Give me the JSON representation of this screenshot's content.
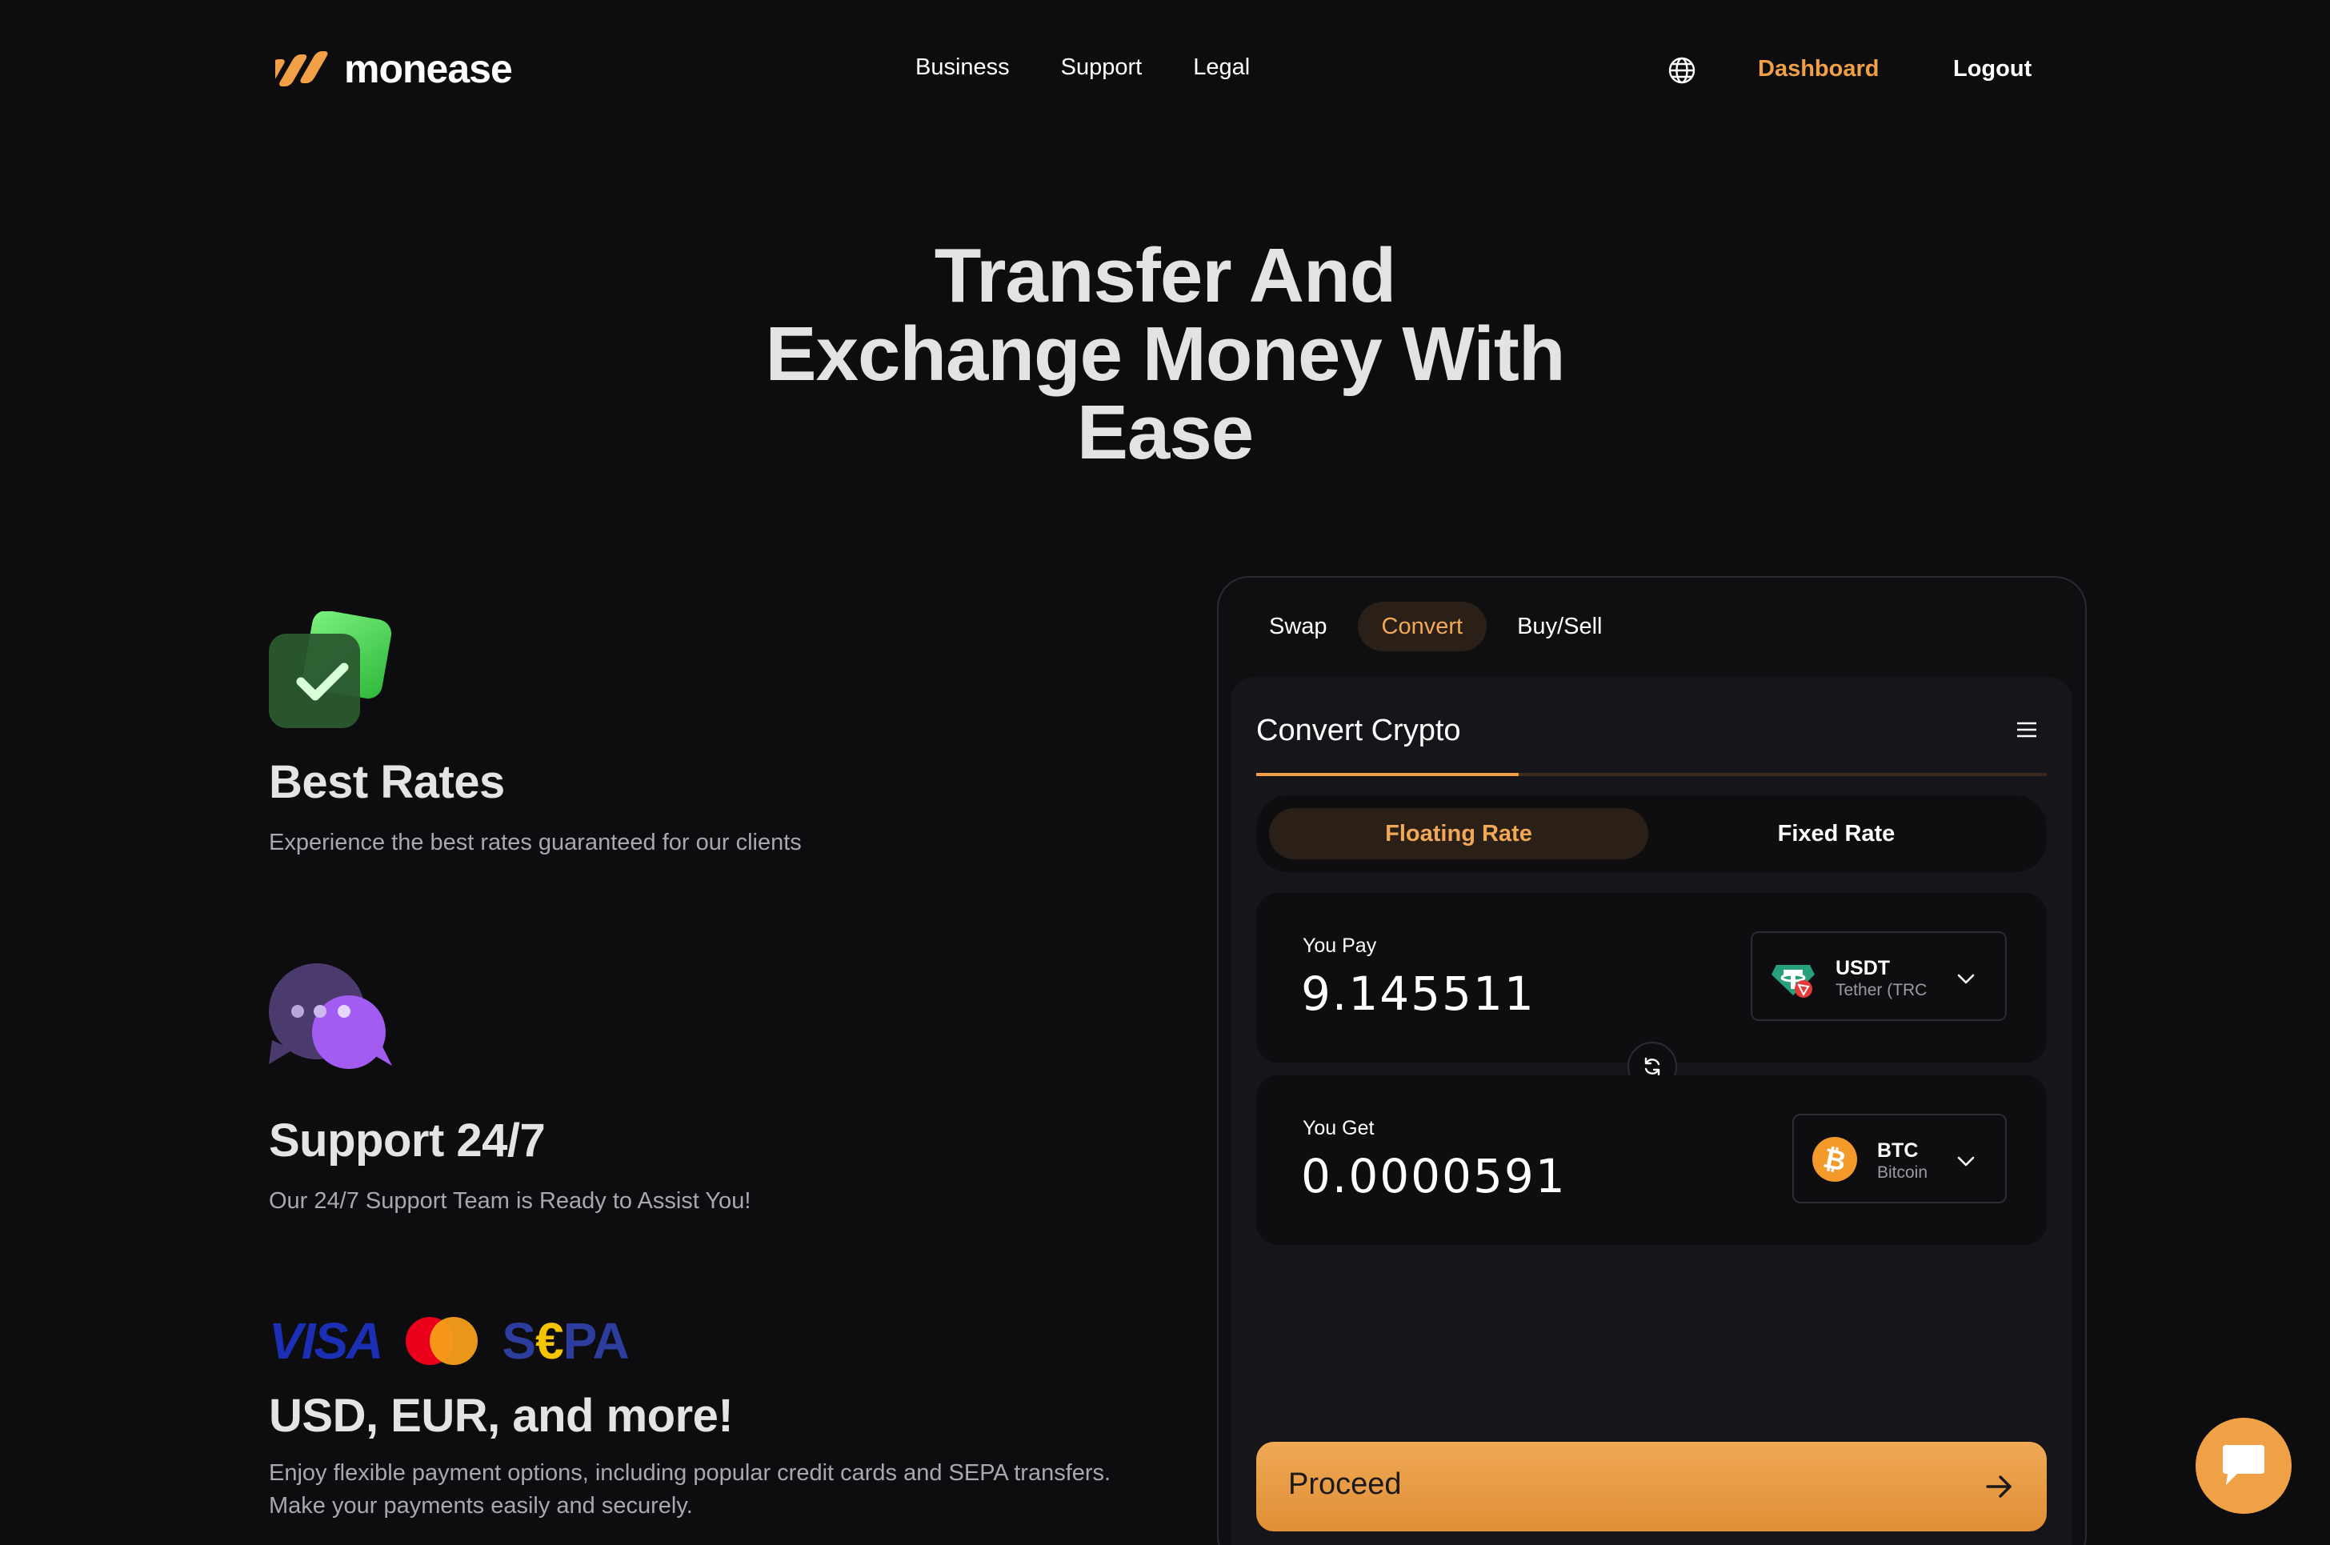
{
  "header": {
    "logo_text": "monease",
    "nav": [
      "Business",
      "Support",
      "Legal"
    ],
    "dashboard_label": "Dashboard",
    "logout_label": "Logout",
    "accent_color": "#f2a046"
  },
  "hero": {
    "line1": "Transfer And",
    "line2": "Exchange Money With",
    "line3": "Ease"
  },
  "features": [
    {
      "title": "Best Rates",
      "description": "Experience the best rates guaranteed for our clients",
      "icon": "check-card-icon"
    },
    {
      "title": "Support 24/7",
      "description": "Our 24/7 Support Team is Ready to Assist You!",
      "icon": "chat-bubbles-icon"
    },
    {
      "title": "USD, EUR, and more!",
      "description_line1": "Enjoy flexible payment options, including popular credit cards and SEPA transfers.",
      "description_line2": "Make your payments easily and securely.",
      "logos": {
        "visa": "VISA",
        "sepa_s": "S",
        "sepa_euro": "€",
        "sepa_pa": "PA"
      }
    }
  ],
  "exchange": {
    "tabs": [
      "Swap",
      "Convert",
      "Buy/Sell"
    ],
    "active_tab": "Convert",
    "title": "Convert Crypto",
    "rate_options": [
      "Floating Rate",
      "Fixed Rate"
    ],
    "active_rate": "Floating Rate",
    "pay": {
      "label": "You Pay",
      "amount": "9.145511",
      "symbol": "USDT",
      "network": "Tether (TRC"
    },
    "get": {
      "label": "You Get",
      "amount": "0.0000591",
      "symbol": "BTC",
      "network": "Bitcoin"
    },
    "proceed_label": "Proceed"
  }
}
